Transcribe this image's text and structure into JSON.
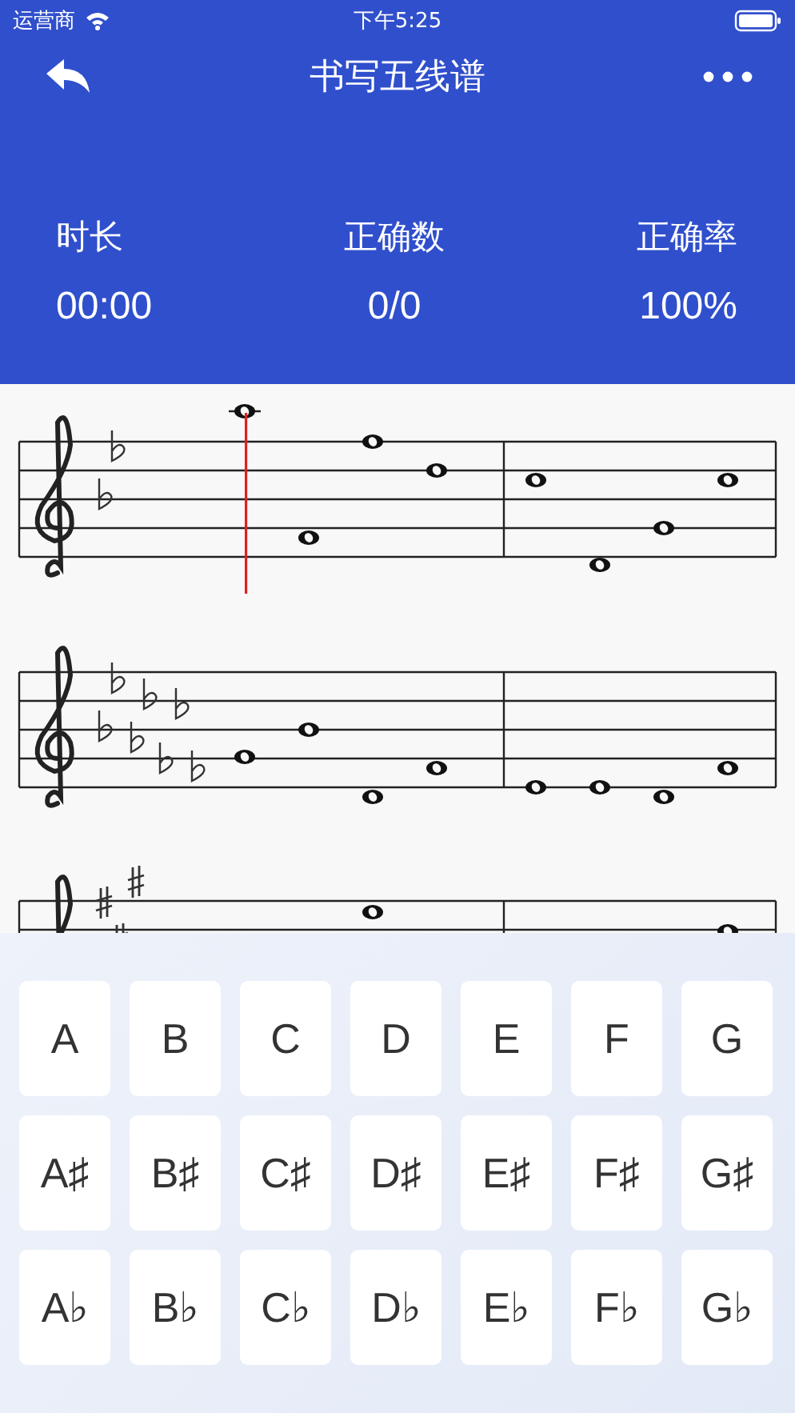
{
  "status_bar": {
    "carrier": "运营商",
    "time": "下午5:25"
  },
  "nav": {
    "title": "书写五线谱"
  },
  "stats": [
    {
      "label": "时长",
      "value": "00:00"
    },
    {
      "label": "正确数",
      "value": "0/0"
    },
    {
      "label": "正确率",
      "value": "100%"
    }
  ],
  "keyboard": [
    [
      "A",
      "B",
      "C",
      "D",
      "E",
      "F",
      "G"
    ],
    [
      "A♯",
      "B♯",
      "C♯",
      "D♯",
      "E♯",
      "F♯",
      "G♯"
    ],
    [
      "A♭",
      "B♭",
      "C♭",
      "D♭",
      "E♭",
      "F♭",
      "G♭"
    ]
  ]
}
